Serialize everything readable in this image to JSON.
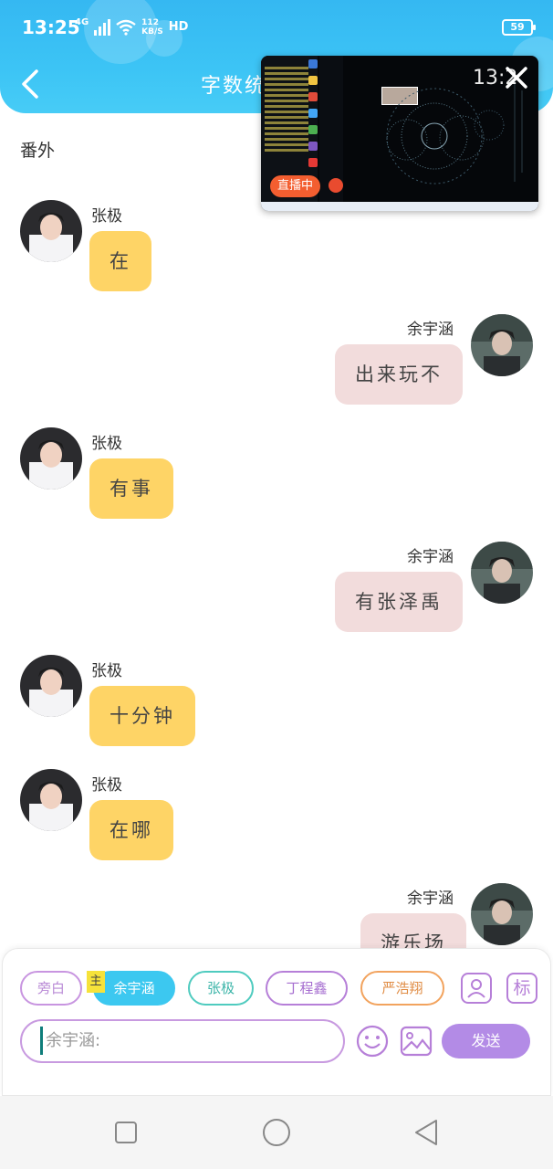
{
  "status_bar": {
    "time": "13:25",
    "network": "4G",
    "speed_value": "112",
    "speed_unit": "KB/S",
    "hd_label": "HD",
    "battery": "59"
  },
  "header": {
    "title": "字数统计"
  },
  "live_window": {
    "time": "13:2",
    "badge": "直播中"
  },
  "chat": {
    "subheading": "番外",
    "messages": [
      {
        "sender": "张极",
        "text": "在"
      },
      {
        "sender": "余宇涵",
        "text": "出来玩不"
      },
      {
        "sender": "张极",
        "text": "有事"
      },
      {
        "sender": "余宇涵",
        "text": "有张泽禹"
      },
      {
        "sender": "张极",
        "text": "十分钟"
      },
      {
        "sender": "张极",
        "text": "在哪"
      },
      {
        "sender": "余宇涵",
        "text": "游乐场"
      }
    ]
  },
  "input_panel": {
    "chips": [
      {
        "label": "旁白",
        "color": "#c895e0"
      },
      {
        "label": "余宇涵",
        "color": "#3cc8f0"
      },
      {
        "label": "张极",
        "color": "#4fcbbf"
      },
      {
        "label": "丁程鑫",
        "color": "#b67fd8"
      },
      {
        "label": "严浩翔",
        "color": "#f2a35e"
      }
    ],
    "main_tag": "主",
    "label_button": "标",
    "input_placeholder": "余宇涵:",
    "send_label": "发送"
  },
  "colors": {
    "header": "#3cc4f5",
    "left_bubble": "#fed466",
    "right_bubble": "#f2dcdc",
    "accent": "#b38be6"
  }
}
